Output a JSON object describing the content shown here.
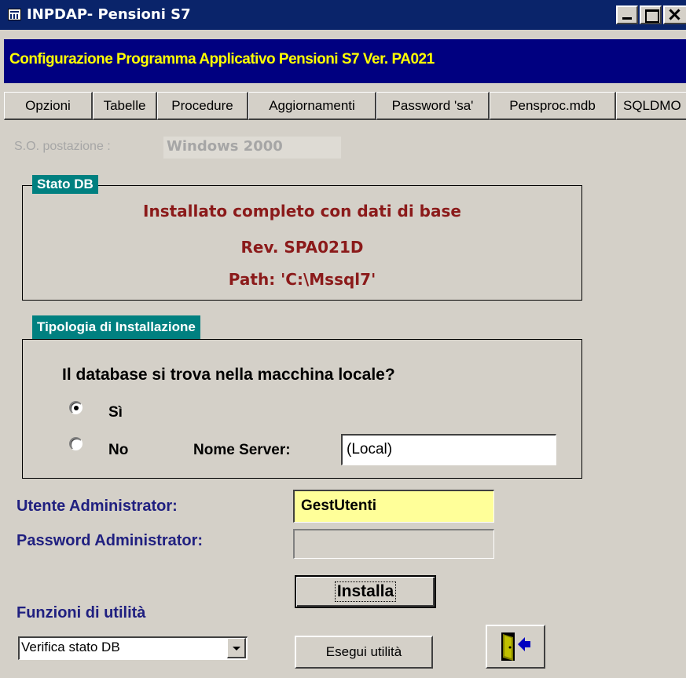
{
  "window": {
    "title": "INPDAP- Pensioni S7",
    "icon": "access-form-icon"
  },
  "header": {
    "title": "Configurazione Programma Applicativo Pensioni S7 Ver. PA021"
  },
  "menu_tabs": [
    {
      "label": "Opzioni"
    },
    {
      "label": "Tabelle"
    },
    {
      "label": "Procedure"
    },
    {
      "label": "Aggiornamenti"
    },
    {
      "label": "Password 'sa'"
    },
    {
      "label": "Pensproc.mdb"
    },
    {
      "label": "SQLDMO"
    }
  ],
  "so": {
    "label": "S.O. postazione :",
    "value": "Windows 2000"
  },
  "stato_db": {
    "title": "Stato DB",
    "lines": [
      "Installato completo con dati di base",
      "Rev. SPA021D",
      "Path: 'C:\\Mssql7'"
    ]
  },
  "tipologia": {
    "title": "Tipologia di Installazione",
    "question": "Il database si trova nella macchina locale?",
    "options": [
      {
        "label": "Sì",
        "selected": true
      },
      {
        "label": "No",
        "selected": false
      }
    ],
    "server_label": "Nome Server:",
    "server_value": "(Local)"
  },
  "admin": {
    "utente_label": "Utente Administrator:",
    "utente_value": "GestUtenti",
    "password_label": "Password Administrator:",
    "password_value": ""
  },
  "buttons": {
    "installa": "Installa",
    "esegui": "Esegui utilità",
    "exit_icon": "exit-door-icon"
  },
  "funzioni": {
    "label": "Funzioni di utilità",
    "selected": "Verifica stato DB"
  },
  "colors": {
    "title_bar": "#0a246a",
    "header_bg": "#000080",
    "header_text": "#ffff00",
    "group_tag": "#008080",
    "stato_text": "#8b1a1a",
    "label_blue": "#202080",
    "highlight_input": "#ffff99",
    "window_bg": "#d4d0c8"
  }
}
